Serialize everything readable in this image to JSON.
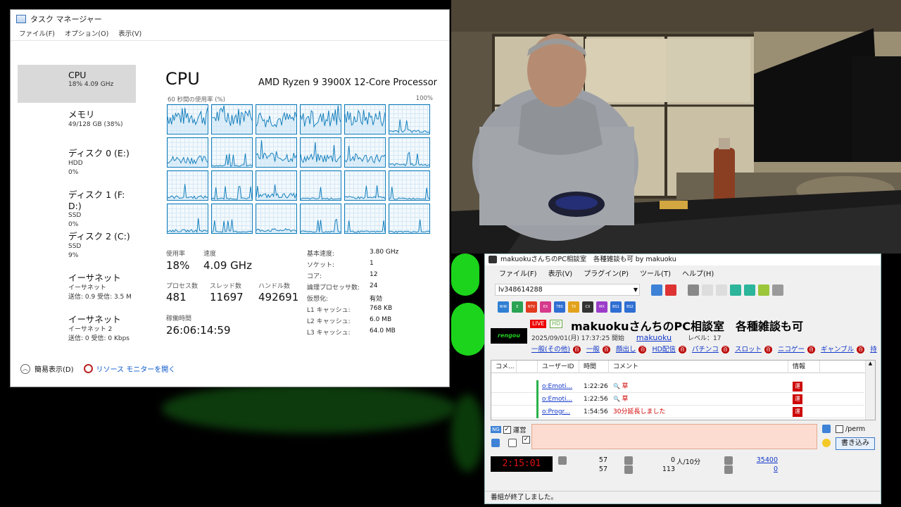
{
  "taskmgr": {
    "title": "タスク マネージャー",
    "menu": [
      "ファイル(F)",
      "オプション(O)",
      "表示(V)"
    ],
    "side": [
      {
        "title": "CPU",
        "l1": "18%  4.09 GHz",
        "l2": "",
        "l3": ""
      },
      {
        "title": "メモリ",
        "l1": "49/128 GB (38%)",
        "l2": "",
        "l3": ""
      },
      {
        "title": "ディスク 0 (E:)",
        "l1": "HDD",
        "l2": "0%",
        "l3": ""
      },
      {
        "title": "ディスク 1 (F: D:)",
        "l1": "SSD",
        "l2": "0%",
        "l3": ""
      },
      {
        "title": "ディスク 2 (C:)",
        "l1": "SSD",
        "l2": "9%",
        "l3": ""
      },
      {
        "title": "イーサネット",
        "l1": "イーサネット",
        "l2": "送信: 0.9 受信: 3.5 M",
        "l3": ""
      },
      {
        "title": "イーサネット",
        "l1": "イーサネット 2",
        "l2": "送信: 0 受信: 0 Kbps",
        "l3": ""
      }
    ],
    "heading": "CPU",
    "processor": "AMD Ryzen 9 3900X 12-Core Processor",
    "axis_left": "60 秒間の使用率 (%)",
    "axis_right": "100%",
    "stats": {
      "usage_label": "使用率",
      "usage": "18%",
      "speed_label": "速度",
      "speed": "4.09 GHz",
      "proc_label": "プロセス数",
      "proc": "481",
      "thread_label": "スレッド数",
      "thread": "11697",
      "handle_label": "ハンドル数",
      "handle": "492691",
      "uptime_label": "稼働時間",
      "uptime": "26:06:14:59"
    },
    "kv": [
      {
        "k": "基本速度:",
        "v": "3.80 GHz"
      },
      {
        "k": "ソケット:",
        "v": "1"
      },
      {
        "k": "コア:",
        "v": "12"
      },
      {
        "k": "論理プロセッサ数:",
        "v": "24"
      },
      {
        "k": "仮想化:",
        "v": "有効"
      },
      {
        "k": "L1 キャッシュ:",
        "v": "768 KB"
      },
      {
        "k": "L2 キャッシュ:",
        "v": "6.0 MB"
      },
      {
        "k": "L3 キャッシュ:",
        "v": "64.0 MB"
      }
    ],
    "footer_left": "簡易表示(D)",
    "footer_link": "リソース モニターを開く"
  },
  "viewer": {
    "title": "makuokuさんちのPC相談室　各種雑談も可 by makuoku",
    "menu": [
      "ファイル(F)",
      "表示(V)",
      "プラグイン(P)",
      "ツール(T)",
      "ヘルプ(H)"
    ],
    "live_id": "lv348614288",
    "chips": [
      "NHK",
      "E",
      "NTV",
      "EX",
      "TBS",
      "TX",
      "CX",
      "MX",
      "BS1",
      "BS2"
    ],
    "logo": "rengou",
    "badge_live": "LIVE",
    "badge_hd": "HD",
    "program_title": "makuokuさんちのPC相談室　各種雑談も可",
    "start_text": "2025/09/01(月) 17:37:25 開始",
    "owner": "makuoku",
    "level": "レベル：17",
    "tags": [
      "一般(その他)",
      "一般",
      "顔出し",
      "HD配信",
      "パチンコ",
      "スロット",
      "ニコゲー",
      "ギャンブル",
      "持"
    ],
    "columns": [
      "コメ...",
      "ユーザーID",
      "時間",
      "コメント",
      "情報"
    ],
    "rows": [
      {
        "uid": "o:Emoti...",
        "time": "1:22:26",
        "comment": "草",
        "info": "運"
      },
      {
        "uid": "o:Emoti...",
        "time": "1:22:56",
        "comment": "草",
        "info": "運"
      },
      {
        "uid": "o:Progr...",
        "time": "1:54:56",
        "comment": "30分延長しました",
        "info": "運"
      }
    ],
    "ng_label": "NG",
    "unei_label": "運営",
    "perm_label": "/perm",
    "write_button": "書き込み",
    "timer": "2:15:01",
    "count1": "57",
    "count2": "57",
    "count3": "0",
    "per10": "人/10分",
    "count4": "113",
    "count5": "35400",
    "count6": "0",
    "status": "番組が終了しました。"
  }
}
